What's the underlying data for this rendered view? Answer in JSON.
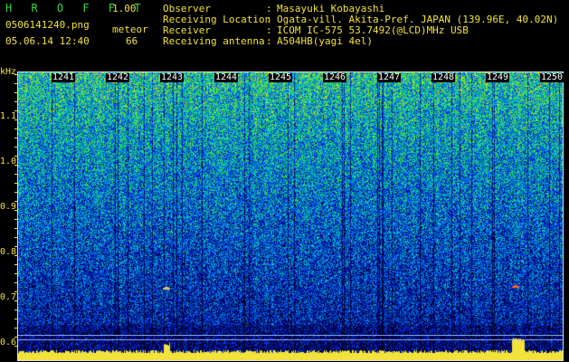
{
  "app": {
    "name": "H R O F F T",
    "version": "1.00"
  },
  "file": {
    "name": "0506141240.png",
    "datetime": "05.06.14 12:40"
  },
  "meteor": {
    "label": "meteor",
    "count": "66"
  },
  "info": [
    {
      "label": "Observer",
      "sep": ":",
      "value": "Masayuki Kobayashi"
    },
    {
      "label": "Receiving Location",
      "sep": ":",
      "value": "Ogata-vill. Akita-Pref. JAPAN (139.96E, 40.02N)"
    },
    {
      "label": "Receiver",
      "sep": ":",
      "value": "ICOM IC-575 53.7492(@LCD)MHz USB"
    },
    {
      "label": "Receiving antenna",
      "sep": ":",
      "value": "A504HB(yagi 4el)"
    }
  ],
  "yaxis": {
    "unit": "kHz",
    "ticks": [
      "1.1",
      "1.0",
      "0.9",
      "0.8",
      "0.7",
      "0.6"
    ]
  },
  "xaxis": {
    "minutes": [
      "1241",
      "1242",
      "1243",
      "1244",
      "1245",
      "1246",
      "1247",
      "1248",
      "1249",
      "1250"
    ]
  },
  "colors": {
    "text_green": "#39d84a",
    "text_yellow": "#f2e23c",
    "minute_label": "#ffffff",
    "baseline": "#f2e23c"
  }
}
